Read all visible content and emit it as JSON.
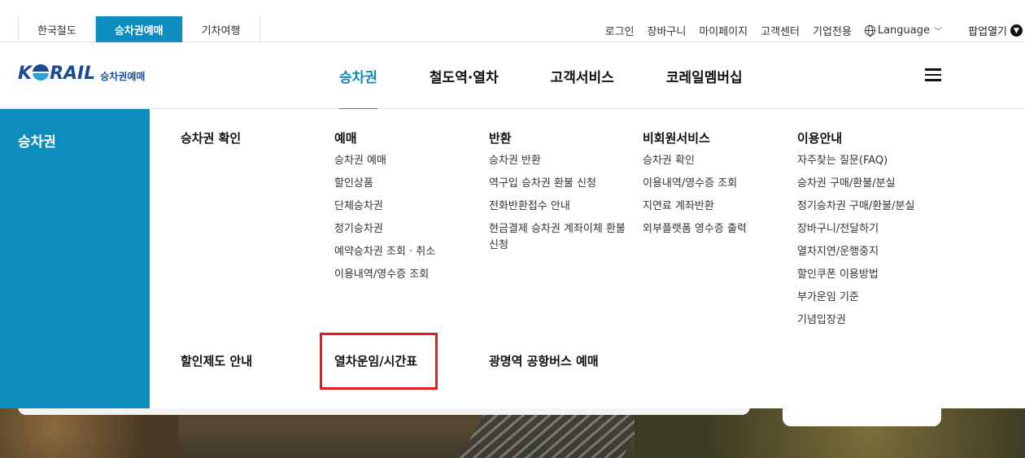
{
  "site_tabs": [
    {
      "label": "한국철도",
      "active": false
    },
    {
      "label": "승차권예매",
      "active": true
    },
    {
      "label": "기차여행",
      "active": false
    }
  ],
  "util_links": {
    "login": "로그인",
    "cart": "장바구니",
    "mypage": "마이페이지",
    "customer_center": "고객센터",
    "corporate": "기업전용",
    "language": "Language",
    "popup": "팝업열기"
  },
  "logo": {
    "main_before": "K",
    "main_after": "RAIL",
    "sub": "승차권예매"
  },
  "gnb": [
    "승차권",
    "철도역·열차",
    "고객서비스",
    "코레일멤버십"
  ],
  "mega": {
    "side_title": "승차권",
    "columns": [
      {
        "title": "승차권 확인",
        "items": []
      },
      {
        "title": "예매",
        "items": [
          "승차권 예매",
          "할인상품",
          "단체승차권",
          "정기승차권",
          "예약승차권 조회 · 취소",
          "이용내역/영수증 조회"
        ]
      },
      {
        "title": "반환",
        "items": [
          "승차권 반환",
          "역구입 승차권 환불 신청",
          "전화반환접수 안내",
          "현금결제 승차권 계좌이체 환불신청"
        ]
      },
      {
        "title": "비회원서비스",
        "items": [
          "승차권 확인",
          "이용내역/영수증 조회",
          "지연료 계좌반환",
          "외부플랫폼 영수증 출력"
        ]
      },
      {
        "title": "이용안내",
        "items": [
          "자주찾는 질문(FAQ)",
          "승차권 구매/환불/분실",
          "정기승차권 구매/환불/분실",
          "장바구니/전달하기",
          "열차지연/운행중지",
          "할인쿠폰 이용방법",
          "부가운임 기준",
          "기념입장권"
        ]
      }
    ],
    "bottom_links": [
      "할인제도 안내",
      "열차운임/시간표",
      "광명역 공항버스 예매"
    ]
  }
}
